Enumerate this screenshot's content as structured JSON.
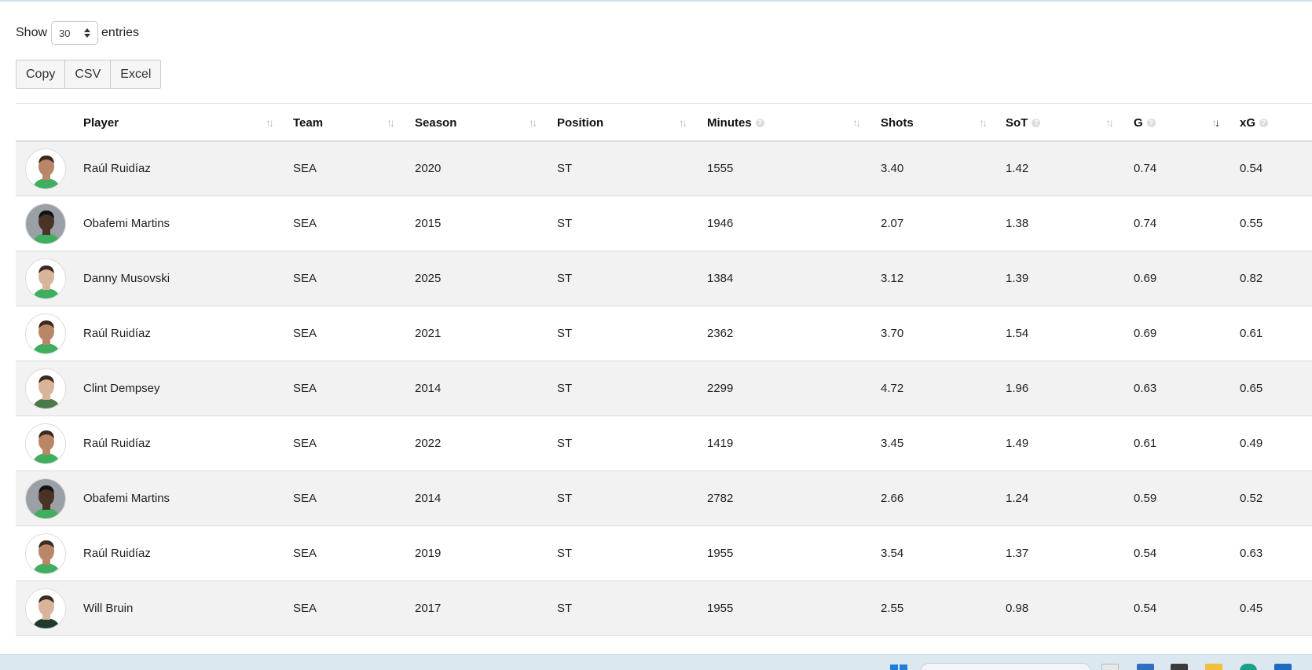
{
  "length_control": {
    "prefix": "Show",
    "value": "30",
    "suffix": "entries"
  },
  "buttons": {
    "copy": "Copy",
    "csv": "CSV",
    "excel": "Excel"
  },
  "columns": {
    "player": "Player",
    "team": "Team",
    "season": "Season",
    "position": "Position",
    "minutes": "Minutes",
    "shots": "Shots",
    "sot": "SoT",
    "g": "G",
    "xg": "xG"
  },
  "rows": [
    {
      "player": "Raúl Ruidíaz",
      "team": "SEA",
      "season": "2020",
      "position": "ST",
      "minutes": "1555",
      "shots": "3.40",
      "sot": "1.42",
      "g": "0.74",
      "xg": "0.54"
    },
    {
      "player": "Obafemi Martins",
      "team": "SEA",
      "season": "2015",
      "position": "ST",
      "minutes": "1946",
      "shots": "2.07",
      "sot": "1.38",
      "g": "0.74",
      "xg": "0.55"
    },
    {
      "player": "Danny Musovski",
      "team": "SEA",
      "season": "2025",
      "position": "ST",
      "minutes": "1384",
      "shots": "3.12",
      "sot": "1.39",
      "g": "0.69",
      "xg": "0.82"
    },
    {
      "player": "Raúl Ruidíaz",
      "team": "SEA",
      "season": "2021",
      "position": "ST",
      "minutes": "2362",
      "shots": "3.70",
      "sot": "1.54",
      "g": "0.69",
      "xg": "0.61"
    },
    {
      "player": "Clint Dempsey",
      "team": "SEA",
      "season": "2014",
      "position": "ST",
      "minutes": "2299",
      "shots": "4.72",
      "sot": "1.96",
      "g": "0.63",
      "xg": "0.65"
    },
    {
      "player": "Raúl Ruidíaz",
      "team": "SEA",
      "season": "2022",
      "position": "ST",
      "minutes": "1419",
      "shots": "3.45",
      "sot": "1.49",
      "g": "0.61",
      "xg": "0.49"
    },
    {
      "player": "Obafemi Martins",
      "team": "SEA",
      "season": "2014",
      "position": "ST",
      "minutes": "2782",
      "shots": "2.66",
      "sot": "1.24",
      "g": "0.59",
      "xg": "0.52"
    },
    {
      "player": "Raúl Ruidíaz",
      "team": "SEA",
      "season": "2019",
      "position": "ST",
      "minutes": "1955",
      "shots": "3.54",
      "sot": "1.37",
      "g": "0.54",
      "xg": "0.63"
    },
    {
      "player": "Will Bruin",
      "team": "SEA",
      "season": "2017",
      "position": "ST",
      "minutes": "1955",
      "shots": "2.55",
      "sot": "0.98",
      "g": "0.54",
      "xg": "0.45"
    }
  ],
  "colors": {
    "row_stripe": "#f2f2f2",
    "jersey_green": "#3fae5f",
    "jersey_dark": "#1f3a2c",
    "taskbar_bg": "#dbe8f0"
  },
  "icons": [
    "sort-icon",
    "info-icon",
    "avatar-photo",
    "windows-start-icon",
    "taskbar-search"
  ]
}
